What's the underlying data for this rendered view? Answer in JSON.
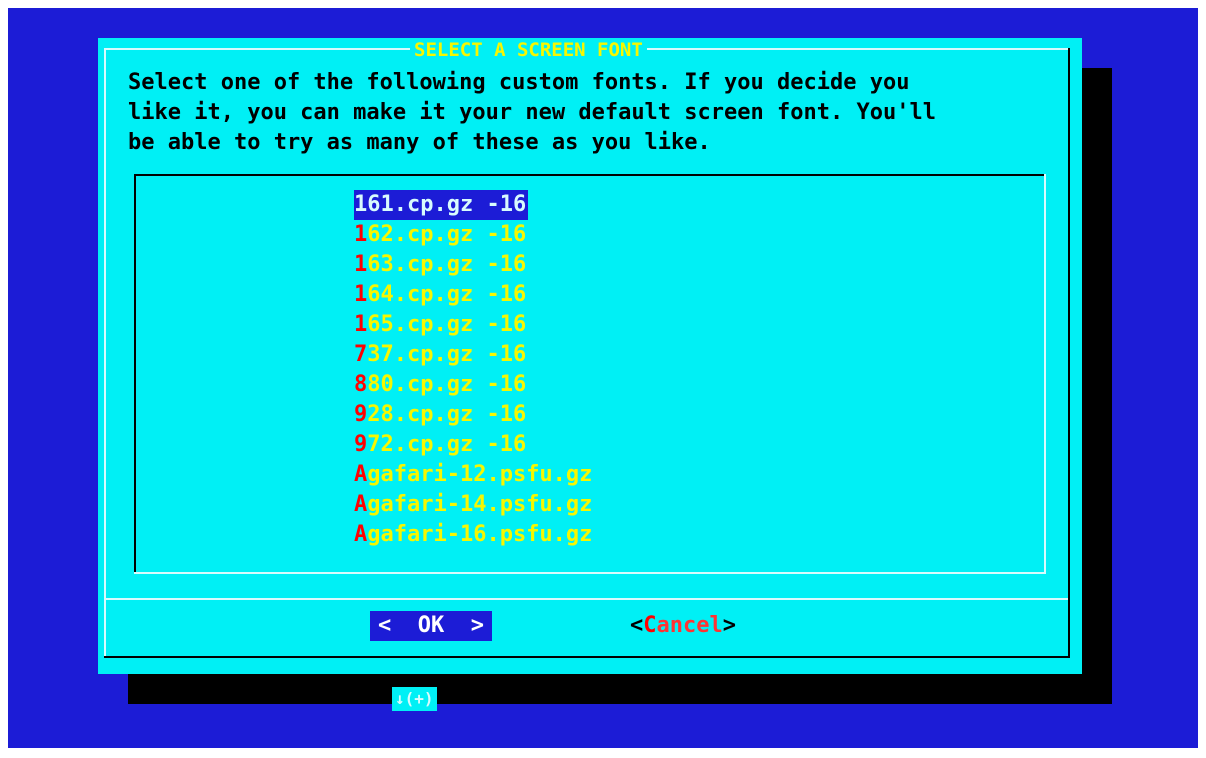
{
  "dialog": {
    "title": "SELECT A SCREEN FONT",
    "description": "Select one of the following custom fonts. If you decide you\nlike it, you can make it your new default screen font. You'll\nbe able to try as many of these as you like."
  },
  "list": {
    "items": [
      {
        "hot": "1",
        "rest": "61.cp.gz -16",
        "selected": true
      },
      {
        "hot": "1",
        "rest": "62.cp.gz -16"
      },
      {
        "hot": "1",
        "rest": "63.cp.gz -16"
      },
      {
        "hot": "1",
        "rest": "64.cp.gz -16"
      },
      {
        "hot": "1",
        "rest": "65.cp.gz -16"
      },
      {
        "hot": "7",
        "rest": "37.cp.gz -16"
      },
      {
        "hot": "8",
        "rest": "80.cp.gz -16"
      },
      {
        "hot": "9",
        "rest": "28.cp.gz -16"
      },
      {
        "hot": "9",
        "rest": "72.cp.gz -16"
      },
      {
        "hot": "A",
        "rest": "gafari-12.psfu.gz"
      },
      {
        "hot": "A",
        "rest": "gafari-14.psfu.gz"
      },
      {
        "hot": "A",
        "rest": "gafari-16.psfu.gz"
      }
    ],
    "more_indicator": "↓(+)"
  },
  "buttons": {
    "ok": {
      "left": "<",
      "label": "OK",
      "right": ">"
    },
    "cancel": {
      "left": "<",
      "hot": "C",
      "rest": "ancel",
      "right": ">"
    }
  },
  "colors": {
    "background": "#1c1cd6",
    "dialog": "#00f0f5",
    "item_text": "#f7f700",
    "hotkey": "#ff0000",
    "shadow": "#000000"
  }
}
